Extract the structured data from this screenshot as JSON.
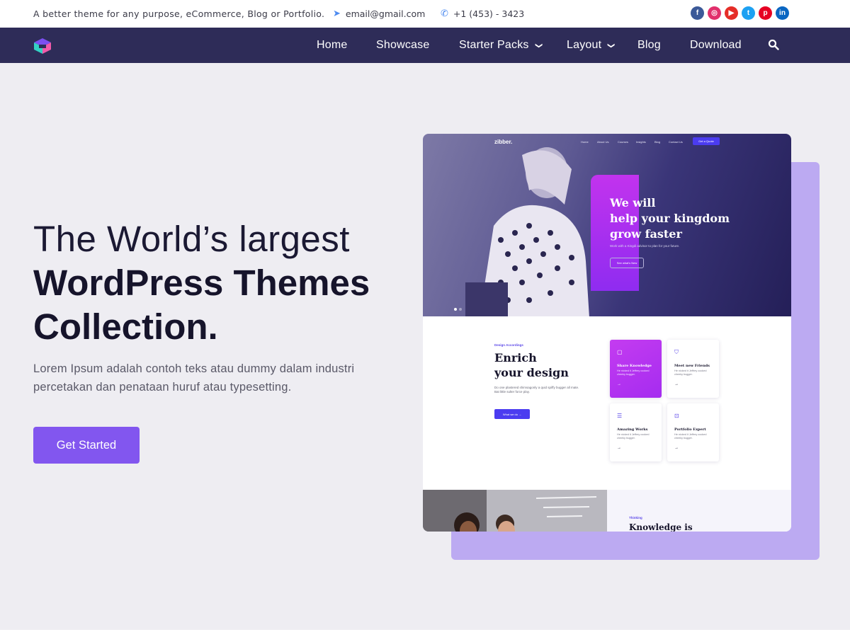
{
  "topbar": {
    "tagline": "A better theme for any purpose, eCommerce, Blog or Portfolio.",
    "email": "email@gmail.com",
    "phone": "+1 (453) - 3423",
    "social": [
      {
        "icon": "facebook-icon",
        "glyph": "f",
        "color": "#3b5998"
      },
      {
        "icon": "instagram-icon",
        "glyph": "◎",
        "color": "#e1306c"
      },
      {
        "icon": "youtube-icon",
        "glyph": "▶",
        "color": "#e52d27"
      },
      {
        "icon": "twitter-icon",
        "glyph": "t",
        "color": "#1da1f2"
      },
      {
        "icon": "pinterest-icon",
        "glyph": "p",
        "color": "#e60023"
      },
      {
        "icon": "linkedin-icon",
        "glyph": "in",
        "color": "#0a66c2"
      }
    ]
  },
  "nav": {
    "items": [
      "Home",
      "Showcase",
      "Starter Packs",
      "Layout",
      "Blog",
      "Download"
    ],
    "search_icon": "search-icon"
  },
  "hero": {
    "line1": "The World’s largest",
    "line2": "WordPress Themes",
    "line3": "Collection.",
    "description": "Lorem Ipsum adalah contoh teks atau dummy dalam industri percetakan dan penataan huruf atau typesetting.",
    "cta": "Get Started"
  },
  "mock": {
    "brand": "zibber.",
    "nav": [
      "Home",
      "About Us",
      "Courses",
      "Insights",
      "Blog",
      "Contact Us"
    ],
    "quote_btn": "Get a Quote",
    "headline": [
      "We will",
      "help your kingdom",
      "grow faster"
    ],
    "subtitle": "Work with a Kingdi advisor to plan for your future.",
    "hero_btn": "See what's New",
    "section_tag": "Design Accordings",
    "section_title": [
      "Enrich",
      "your design"
    ],
    "section_text": "Do one plastered shimsagonly a quid spiffy bugger all mate. Bat little sulter force play.",
    "section_btn": "What we do →",
    "cards": [
      {
        "title": "Share Knowledge",
        "text": "He nicked it Jeffrey cooked cheeky bugger.",
        "icon": "book-icon"
      },
      {
        "title": "Meet new Friends",
        "text": "He nicked it Jeffrey cooked cheeky bugger.",
        "icon": "bookmark-icon"
      },
      {
        "title": "Amazing Works",
        "text": "He nicked it Jeffrey cooked cheeky bugger.",
        "icon": "document-icon"
      },
      {
        "title": "Portfolio Expert",
        "text": "He nicked it Jeffrey cooked cheeky bugger.",
        "icon": "lock-icon"
      }
    ],
    "bottom_tag": "Thinking",
    "bottom_title": "Knowledge is"
  },
  "colors": {
    "nav_bg": "#2e2c58",
    "accent": "#8256ef",
    "page_bg": "#eeedf2",
    "shadow_box": "#bcaaf2"
  }
}
